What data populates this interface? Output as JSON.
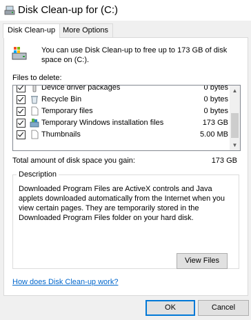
{
  "window": {
    "title": "Disk Clean-up for  (C:)"
  },
  "tabs": [
    {
      "label": "Disk Clean-up",
      "active": true
    },
    {
      "label": "More Options",
      "active": false
    }
  ],
  "intro_text": "You can use Disk Clean-up to free up to 173 GB of disk space on  (C:).",
  "files_label": "Files to delete:",
  "files": [
    {
      "name": "Device driver packages",
      "size": "0 bytes",
      "checked": true,
      "icon": "driver-package-icon"
    },
    {
      "name": "Recycle Bin",
      "size": "0 bytes",
      "checked": true,
      "icon": "recycle-bin-icon"
    },
    {
      "name": "Temporary files",
      "size": "0 bytes",
      "checked": true,
      "icon": "file-icon"
    },
    {
      "name": "Temporary Windows installation files",
      "size": "173 GB",
      "checked": true,
      "icon": "windows-install-icon"
    },
    {
      "name": "Thumbnails",
      "size": "5.00 MB",
      "checked": true,
      "icon": "file-icon"
    }
  ],
  "total": {
    "label": "Total amount of disk space you gain:",
    "value": "173 GB"
  },
  "description": {
    "title": "Description",
    "text": "Downloaded Program Files are ActiveX controls and Java applets downloaded automatically from the Internet when you view certain pages. They are temporarily stored in the Downloaded Program Files folder on your hard disk."
  },
  "buttons": {
    "view_files": "View Files",
    "ok": "OK",
    "cancel": "Cancel"
  },
  "help_link": "How does Disk Clean-up work?",
  "colors": {
    "accent": "#0078d7",
    "link": "#0066cc"
  }
}
